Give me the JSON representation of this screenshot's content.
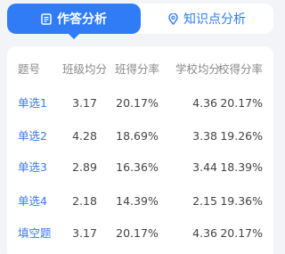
{
  "tabs": [
    {
      "label": "作答分析",
      "icon": "document-icon",
      "active": true
    },
    {
      "label": "知识点分析",
      "icon": "location-pin-icon",
      "active": false
    }
  ],
  "table": {
    "headers": [
      "题号",
      "班级均分",
      "班得分率",
      "学校均分",
      "校得分率"
    ],
    "rows": [
      {
        "q": "单选1",
        "class_avg": "3.17",
        "class_rate": "20.17%",
        "school_avg": "4.36",
        "school_rate": "20.17%"
      },
      {
        "q": "单选2",
        "class_avg": "4.28",
        "class_rate": "18.69%",
        "school_avg": "3.38",
        "school_rate": "19.26%"
      },
      {
        "q": "单选3",
        "class_avg": "2.89",
        "class_rate": "16.36%",
        "school_avg": "3.44",
        "school_rate": "18.39%"
      },
      {
        "q": "单选4",
        "class_avg": "2.18",
        "class_rate": "14.39%",
        "school_avg": "2.15",
        "school_rate": "19.36%"
      },
      {
        "q": "填空题",
        "class_avg": "3.17",
        "class_rate": "20.17%",
        "school_avg": "4.36",
        "school_rate": "20.17%"
      }
    ]
  },
  "colors": {
    "accent": "#2f7cf6",
    "link": "#3a7af0",
    "background": "#f2f4f7"
  }
}
